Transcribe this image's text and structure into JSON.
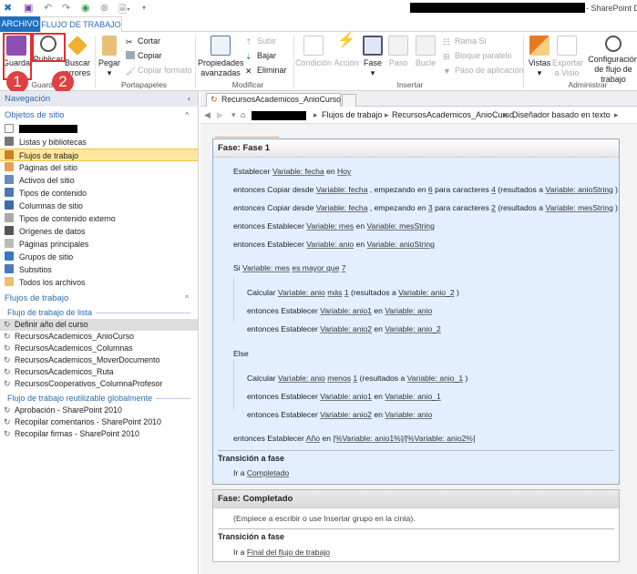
{
  "title": {
    "suffix": "- SharePoint De"
  },
  "ribbon_tabs": [
    "ARCHIVO",
    "FLUJO DE TRABAJO"
  ],
  "ribbon": {
    "guardar": {
      "label": "Guardar",
      "buttons": [
        "Guardar",
        "Publicar",
        "Buscar errores"
      ],
      "group": "Guardar"
    },
    "portapapeles": {
      "pegar": "Pegar",
      "cortar": "Cortar",
      "copiar": "Copiar",
      "copiar_formato": "Copiar formato",
      "group": "Portapapeles"
    },
    "modificar": {
      "propiedades": "Propiedades avanzadas",
      "subir": "Subir",
      "bajar": "Bajar",
      "eliminar": "Eliminar",
      "group": "Modificar"
    },
    "insertar": {
      "condicion": "Condición",
      "accion": "Acción",
      "fase": "Fase",
      "paso": "Paso",
      "bucle": "Bucle",
      "rama_si": "Rama Si",
      "bloque": "Bloque paralelo",
      "paso_app": "Paso de aplicación",
      "group": "Insertar"
    },
    "administrar": {
      "vistas": "Vistas",
      "exportar": "Exportar a Visio",
      "config": "Configuración de flujo de trabajo",
      "group": "Administrar"
    }
  },
  "badges": [
    "1",
    "2"
  ],
  "nav": {
    "title": "Navegación",
    "site_objects": "Objetos de sitio",
    "items": [
      "Listas y bibliotecas",
      "Flujos de trabajo",
      "Páginas del sitio",
      "Activos del sitio",
      "Tipos de contenido",
      "Columnas de sitio",
      "Tipos de contenido externo",
      "Orígenes de datos",
      "Páginas principales",
      "Grupos de sitio",
      "Subsitios",
      "Todos los archivos"
    ],
    "workflows": "Flujos de trabajo",
    "list_wf_header": "Flujo de trabajo de lista",
    "list_wf": [
      "Definir año del curso",
      "RecursosAcademicos_AnioCurso",
      "RecursosAcademicos_Columnas",
      "RecursosAcademicos_MoverDocumento",
      "RecursosAcademicos_Ruta",
      "RecursosCooperativos_ColumnaProfesor"
    ],
    "global_wf_header": "Flujo de trabajo reutilizable globalmente",
    "global_wf": [
      "Aprobación - SharePoint 2010",
      "Recopilar comentarios - SharePoint 2010",
      "Recopilar firmas - SharePoint 2010"
    ]
  },
  "doc_tab": "RecursosAcademicos_AnioCurso *",
  "breadcrumb": [
    "Flujos de trabajo",
    "RecursosAcademicos_AnioCurso",
    "Diseñador basado en texto"
  ],
  "phase1": {
    "title": "Fase: Fase 1",
    "statements": [
      [
        {
          "t": "Establecer "
        },
        {
          "l": "Variable: fecha"
        },
        {
          "t": " en "
        },
        {
          "l": "Hoy"
        }
      ],
      [
        {
          "t": "entonces Copiar desde "
        },
        {
          "l": "Variable: fecha"
        },
        {
          "t": " , empezando en "
        },
        {
          "l": "6"
        },
        {
          "t": " para caracteres "
        },
        {
          "l": "4"
        },
        {
          "t": " (resultados a "
        },
        {
          "l": "Variable: anioString"
        },
        {
          "t": " )"
        }
      ],
      [
        {
          "t": "entonces Copiar desde "
        },
        {
          "l": "Variable: fecha"
        },
        {
          "t": " , empezando en "
        },
        {
          "l": "3"
        },
        {
          "t": " para caracteres "
        },
        {
          "l": "2"
        },
        {
          "t": " (resultados a "
        },
        {
          "l": "Variable: mesString"
        },
        {
          "t": " )"
        }
      ],
      [
        {
          "t": "entonces Establecer "
        },
        {
          "l": "Variable: mes"
        },
        {
          "t": " en "
        },
        {
          "l": "Variable: mesString"
        }
      ],
      [
        {
          "t": "entonces Establecer "
        },
        {
          "l": "Variable: anio"
        },
        {
          "t": " en "
        },
        {
          "l": "Variable: anioString"
        }
      ],
      [
        {
          "t": "Si "
        },
        {
          "l": "Variable: mes"
        },
        {
          "t": " "
        },
        {
          "l": "es mayor que"
        },
        {
          "t": " "
        },
        {
          "l": "7"
        }
      ],
      [
        {
          "t": "Calcular "
        },
        {
          "l": "Variable: anio"
        },
        {
          "t": " "
        },
        {
          "l": "más"
        },
        {
          "t": " "
        },
        {
          "l": "1"
        },
        {
          "t": " (resultados a "
        },
        {
          "l": "Variable: anio_2"
        },
        {
          "t": " )"
        }
      ],
      [
        {
          "t": "entonces Establecer "
        },
        {
          "l": "Variable: anio1"
        },
        {
          "t": " en "
        },
        {
          "l": "Variable: anio"
        }
      ],
      [
        {
          "t": "entonces Establecer "
        },
        {
          "l": "Variable: anio2"
        },
        {
          "t": " en "
        },
        {
          "l": "Variable: anio_2"
        }
      ],
      [
        {
          "t": "Else"
        }
      ],
      [
        {
          "t": "Calcular "
        },
        {
          "l": "Variable: anio"
        },
        {
          "t": " "
        },
        {
          "l": "menos"
        },
        {
          "t": " "
        },
        {
          "l": "1"
        },
        {
          "t": " (resultados a "
        },
        {
          "l": "Variable: anio_1"
        },
        {
          "t": " )"
        }
      ],
      [
        {
          "t": "entonces Establecer "
        },
        {
          "l": "Variable: anio1"
        },
        {
          "t": " en "
        },
        {
          "l": "Variable: anio_1"
        }
      ],
      [
        {
          "t": "entonces Establecer "
        },
        {
          "l": "Variable: anio2"
        },
        {
          "t": " en "
        },
        {
          "l": "Variable: anio"
        }
      ],
      [
        {
          "t": "entonces Establecer "
        },
        {
          "l": "Año"
        },
        {
          "t": " en "
        },
        {
          "l": "[%Variable: anio1%]/[%Variable: anio2%]"
        }
      ]
    ],
    "transition_title": "Transición a fase",
    "goto_prefix": "Ir a ",
    "goto_link": "Completado"
  },
  "phase2": {
    "title": "Fase: Completado",
    "placeholder": "(Empiece a escribir o use Insertar grupo en la cinta).",
    "transition_title": "Transición a fase",
    "goto_prefix": "Ir a ",
    "goto_link": "Final del flujo de trabajo"
  }
}
